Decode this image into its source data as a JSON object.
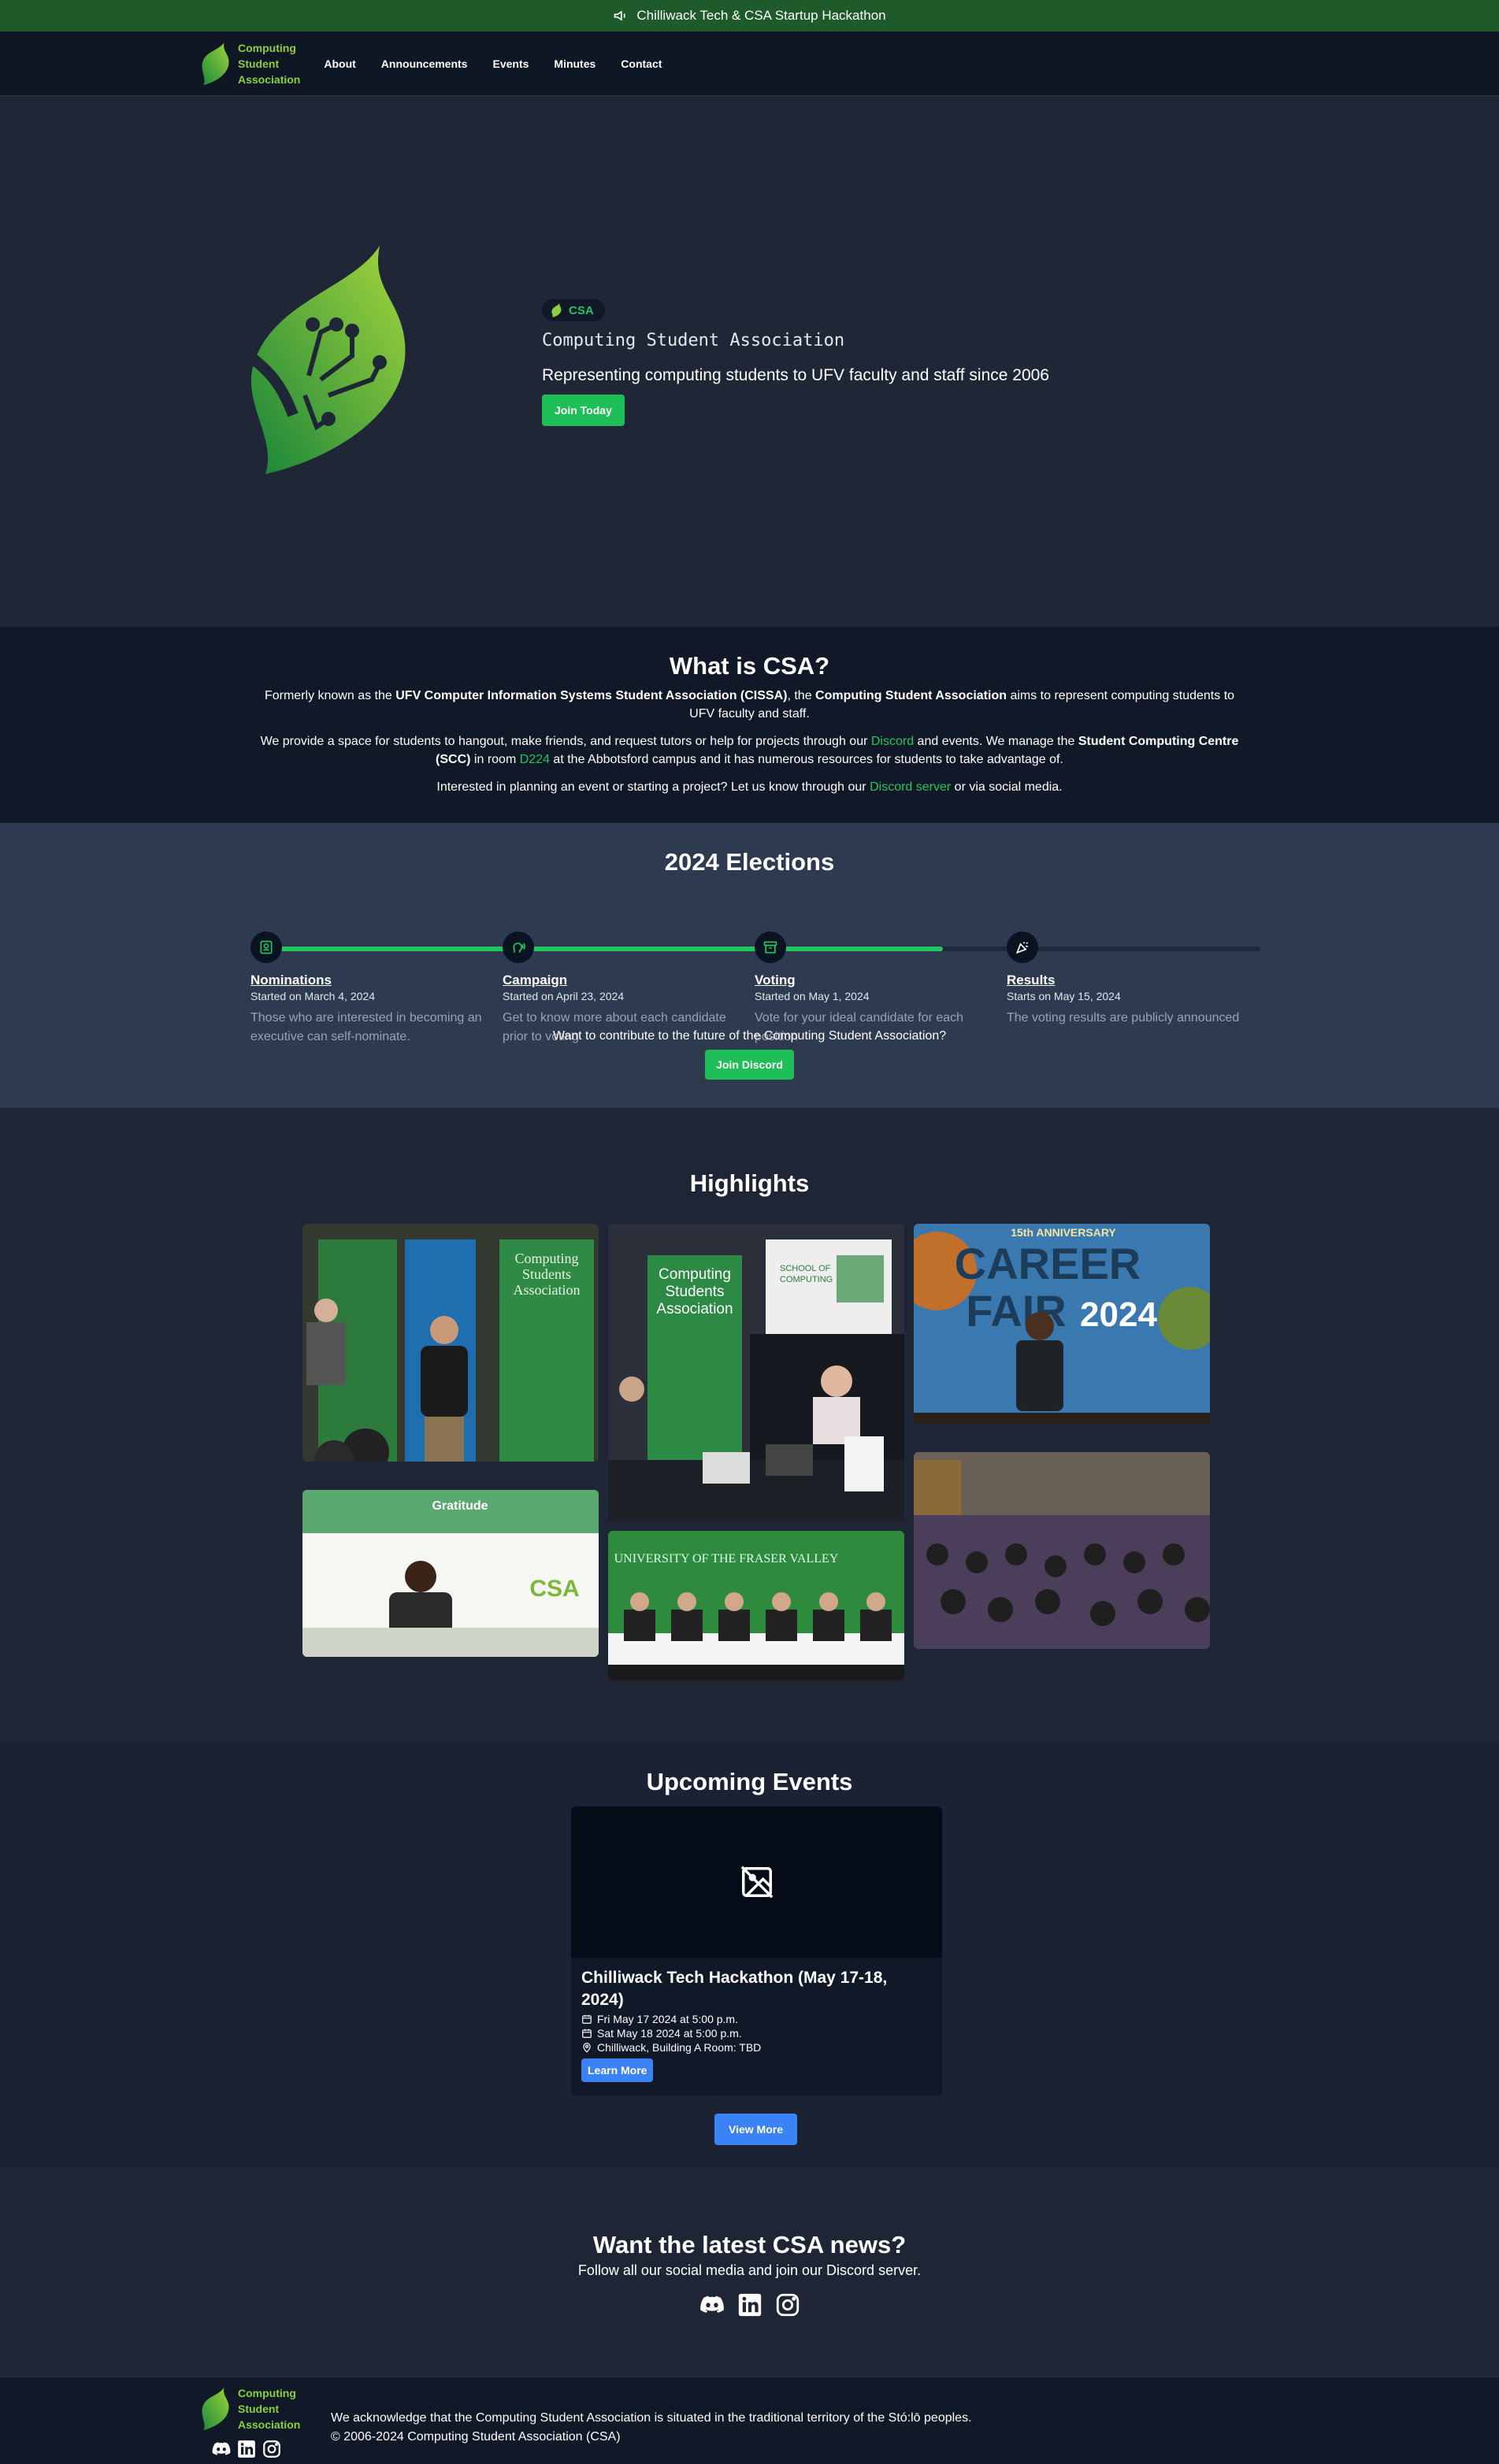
{
  "announcement": {
    "text": "Chilliwack Tech & CSA Startup Hackathon",
    "icon": "megaphone-icon"
  },
  "nav": {
    "brand": [
      "Computing",
      "Student",
      "Association"
    ],
    "links": [
      "About",
      "Announcements",
      "Events",
      "Minutes",
      "Contact"
    ]
  },
  "hero": {
    "badge": "CSA",
    "title": "Computing Student Association",
    "subtitle": "Representing computing students to UFV faculty and staff since 2006",
    "button": "Join Today"
  },
  "what": {
    "heading": "What is CSA?",
    "p1_a": "Formerly known as the ",
    "p1_b": "UFV Computer Information Systems Student Association (CISSA)",
    "p1_c": ", the ",
    "p1_d": "Computing Student Association",
    "p1_e": " aims to represent computing students to UFV faculty and staff.",
    "p2_a": "We provide a space for students to hangout, make friends, and request tutors or help for projects through our ",
    "p2_link": "Discord",
    "p2_b": " and events. We manage the ",
    "p2_c": "Student Computing Centre (SCC)",
    "p2_d": " in room ",
    "p2_room": "D224",
    "p2_e": " at the Abbotsford campus and it has numerous resources for students to take advantage of.",
    "p3_a": "Interested in planning an event or starting a project? Let us know through our ",
    "p3_link": "Discord server",
    "p3_b": " or via social media."
  },
  "elections": {
    "heading": "2024 Elections",
    "progress": 0.68,
    "steps": [
      {
        "title": "Nominations",
        "date": "Started on March 4, 2024",
        "desc": "Those who are interested in becoming an executive can self-nominate."
      },
      {
        "title": "Campaign",
        "date": "Started on April 23, 2024",
        "desc": "Get to know more about each candidate prior to voting"
      },
      {
        "title": "Voting",
        "date": "Started on May 1, 2024",
        "desc": "Vote for your ideal candidate for each position"
      },
      {
        "title": "Results",
        "date": "Starts on May 15, 2024",
        "desc": "The voting results are publicly announced"
      }
    ],
    "cta_text": "Want to contribute to the future of the Computing Student Association?",
    "cta_button": "Join Discord"
  },
  "highlights": {
    "heading": "Highlights",
    "photo_text": {
      "booth": [
        "Computing",
        "Students",
        "Association"
      ],
      "school": [
        "SCHOOL OF",
        "COMPUTING"
      ],
      "career": [
        "15th ANNIVERSARY",
        "CAREER",
        "FAIR",
        "2024"
      ],
      "gratitude": "Gratitude",
      "ufv": "UNIVERSITY OF THE FRASER VALLEY"
    }
  },
  "events": {
    "heading": "Upcoming Events",
    "card": {
      "title": "Chilliwack Tech Hackathon (May 17-18, 2024)",
      "start": "Fri May 17 2024 at 5:00 p.m.",
      "end": "Sat May 18 2024 at 5:00 p.m.",
      "location": "Chilliwack, Building A Room: TBD",
      "button": "Learn More"
    },
    "view_more": "View More"
  },
  "news": {
    "heading": "Want the latest CSA news?",
    "subtitle": "Follow all our social media and join our Discord server."
  },
  "footer": {
    "acknowledgement": "We acknowledge that the Computing Student Association is situated in the traditional territory of the Stó:lō peoples.",
    "copyright": "© 2006-2024 Computing Student Association (CSA)"
  },
  "colors": {
    "accent_green": "#22c55e",
    "brand_green": "#8ccf3f",
    "button_blue": "#3b82f6"
  }
}
